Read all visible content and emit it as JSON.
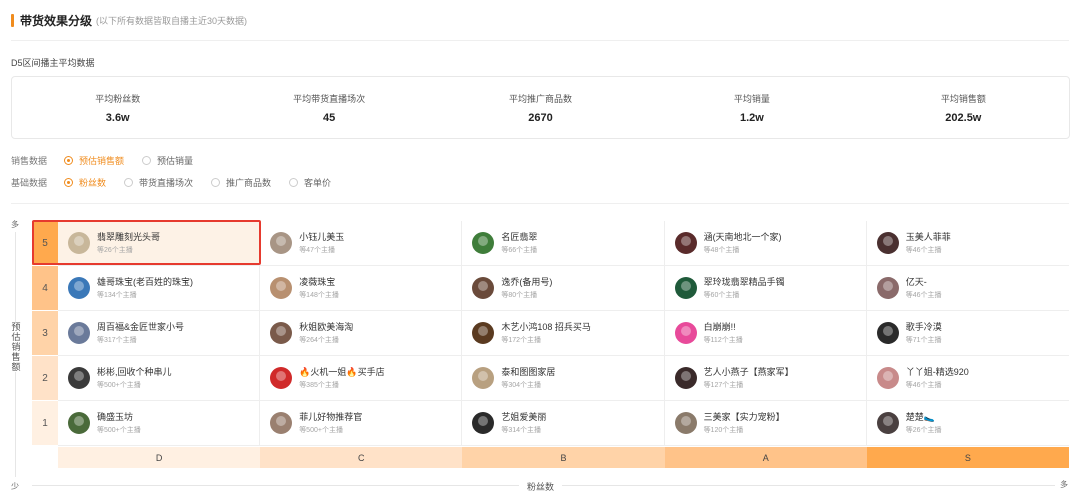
{
  "header": {
    "title": "带货效果分级",
    "subtitle": "(以下所有数据皆取自播主近30天数据)"
  },
  "section_label": "D5区间播主平均数据",
  "stats": [
    {
      "label": "平均粉丝数",
      "value": "3.6w"
    },
    {
      "label": "平均带货直播场次",
      "value": "45"
    },
    {
      "label": "平均推广商品数",
      "value": "2670"
    },
    {
      "label": "平均销量",
      "value": "1.2w"
    },
    {
      "label": "平均销售额",
      "value": "202.5w"
    }
  ],
  "sales_options": {
    "label": "销售数据",
    "options": [
      {
        "label": "预估销售额",
        "selected": true
      },
      {
        "label": "预估销量",
        "selected": false
      }
    ]
  },
  "base_options": {
    "label": "基础数据",
    "options": [
      {
        "label": "粉丝数",
        "selected": true
      },
      {
        "label": "带货直播场次",
        "selected": false
      },
      {
        "label": "推广商品数",
        "selected": false
      },
      {
        "label": "客单价",
        "selected": false
      }
    ]
  },
  "axis": {
    "y_top": "多",
    "y_label": "预估销售额",
    "y_bottom": "少",
    "x_label": "粉丝数",
    "x_right": "多"
  },
  "x_tiers": [
    "D",
    "C",
    "B",
    "A",
    "S"
  ],
  "tier_colors": {
    "row": [
      "#ffa94d",
      "#ffc389",
      "#ffd3a8",
      "#ffe2c8",
      "#fff0e2"
    ],
    "col": [
      "#fff0e2",
      "#ffe2c8",
      "#ffd3a8",
      "#ffc389",
      "#ffa94d"
    ]
  },
  "rows": [
    {
      "rank": "5",
      "cells": [
        {
          "name": "翡翠雕刻光头哥",
          "sub": "等26个主播",
          "color": "#c8b79a",
          "highlight": true
        },
        {
          "name": "小钰儿美玉",
          "sub": "等47个主播",
          "color": "#a89585"
        },
        {
          "name": "名匠翡翠",
          "sub": "等66个主播",
          "color": "#3f7d3a"
        },
        {
          "name": "涵(天南地北一个家)",
          "sub": "等48个主播",
          "color": "#5a2b2b"
        },
        {
          "name": "玉美人菲菲",
          "sub": "等46个主播",
          "color": "#4a3030"
        }
      ]
    },
    {
      "rank": "4",
      "cells": [
        {
          "name": "雄哥珠宝(老百姓的珠宝)",
          "sub": "等134个主播",
          "color": "#3a78b8"
        },
        {
          "name": "凌薇珠宝",
          "sub": "等148个主播",
          "color": "#b89070"
        },
        {
          "name": "逸乔(备用号)",
          "sub": "等80个主播",
          "color": "#6a4a3a"
        },
        {
          "name": "翠玲珑翡翠精品手镯",
          "sub": "等60个主播",
          "color": "#1f5a3a"
        },
        {
          "name": "亿天-",
          "sub": "等46个主播",
          "color": "#8a6a6a"
        }
      ]
    },
    {
      "rank": "3",
      "cells": [
        {
          "name": "周百福&金匠世家小号",
          "sub": "等317个主播",
          "color": "#6a7a9a"
        },
        {
          "name": "秋姐欧美海淘",
          "sub": "等264个主播",
          "color": "#7a5a4a"
        },
        {
          "name": "木艺小鸿108 招兵买马",
          "sub": "等172个主播",
          "color": "#5a3a20"
        },
        {
          "name": "白崩崩!!",
          "sub": "等112个主播",
          "color": "#e84a9a"
        },
        {
          "name": "歌手冷漠",
          "sub": "等71个主播",
          "color": "#2a2a2a"
        }
      ]
    },
    {
      "rank": "2",
      "cells": [
        {
          "name": "彬彬,回收个种串儿",
          "sub": "等500+个主播",
          "color": "#3a3a3a"
        },
        {
          "name": "🔥火机一姐🔥买手店",
          "sub": "等385个主播",
          "color": "#d02a2a"
        },
        {
          "name": "泰和图图家居",
          "sub": "等304个主播",
          "color": "#b8a080"
        },
        {
          "name": "艺人小燕子【燕家军】",
          "sub": "等127个主播",
          "color": "#3a2a2a"
        },
        {
          "name": "丫丫姐-精选920",
          "sub": "等46个主播",
          "color": "#c88a8a"
        }
      ]
    },
    {
      "rank": "1",
      "cells": [
        {
          "name": "确盛玉坊",
          "sub": "等500+个主播",
          "color": "#4a6a3a"
        },
        {
          "name": "菲儿好物推荐官",
          "sub": "等500+个主播",
          "color": "#9a8070"
        },
        {
          "name": "艺姐爱美丽",
          "sub": "等314个主播",
          "color": "#2a2a2a"
        },
        {
          "name": "三美家【实力宠粉】",
          "sub": "等120个主播",
          "color": "#8a7a6a"
        },
        {
          "name": "楚楚🥿",
          "sub": "等26个主播",
          "color": "#4a4040"
        }
      ]
    }
  ]
}
